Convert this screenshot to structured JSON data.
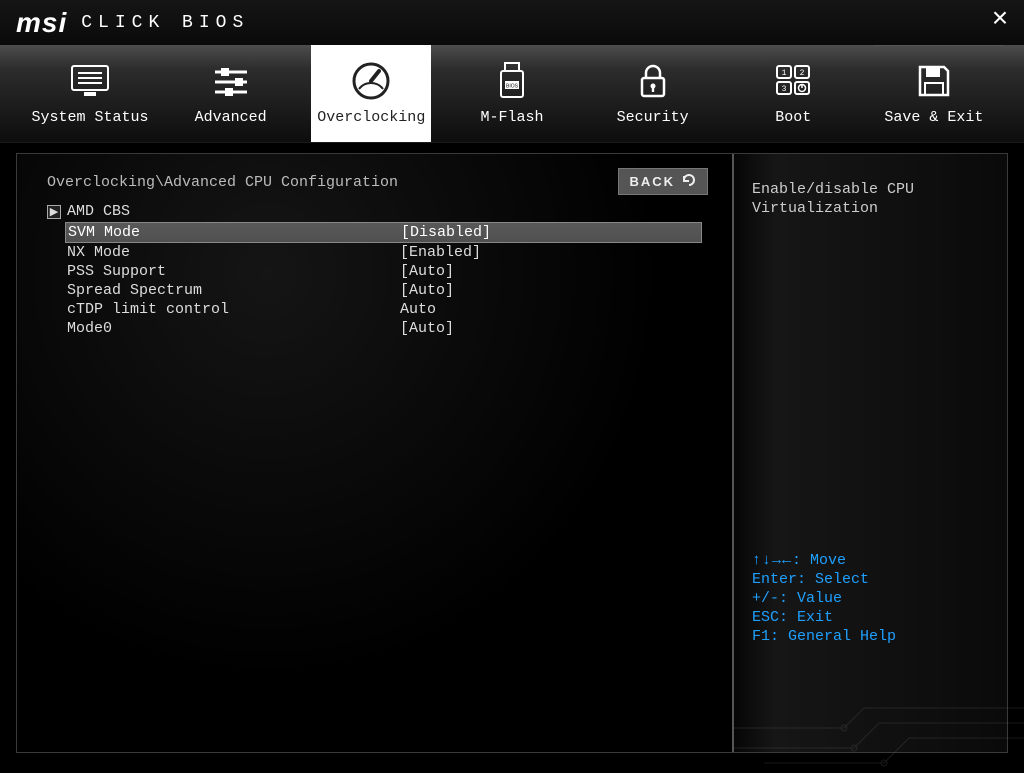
{
  "header": {
    "logo_text": "msi",
    "title": "CLICK BIOS"
  },
  "nav": {
    "items": [
      {
        "id": "system-status",
        "label": "System Status"
      },
      {
        "id": "advanced",
        "label": "Advanced"
      },
      {
        "id": "overclocking",
        "label": "Overclocking",
        "active": true
      },
      {
        "id": "m-flash",
        "label": "M-Flash"
      },
      {
        "id": "security",
        "label": "Security"
      },
      {
        "id": "boot",
        "label": "Boot"
      },
      {
        "id": "save-exit",
        "label": "Save & Exit"
      }
    ]
  },
  "main": {
    "breadcrumb": "Overclocking\\Advanced CPU Configuration",
    "back_label": "BACK",
    "submenu_label": "AMD CBS",
    "rows": [
      {
        "label": "SVM Mode",
        "value": "[Disabled]",
        "selected": true
      },
      {
        "label": "NX Mode",
        "value": "[Enabled]"
      },
      {
        "label": "PSS Support",
        "value": "[Auto]"
      },
      {
        "label": "Spread Spectrum",
        "value": "[Auto]"
      },
      {
        "label": "cTDP limit control",
        "value": "Auto"
      },
      {
        "label": "Mode0",
        "value": "[Auto]"
      }
    ]
  },
  "side": {
    "help_text": "Enable/disable CPU Virtualization",
    "key_help": {
      "arrows_label": "↑↓→←",
      "move": ": Move",
      "enter": "Enter: Select",
      "plusminus": "+/-: Value",
      "esc": "ESC: Exit",
      "f1": "F1: General Help"
    }
  }
}
